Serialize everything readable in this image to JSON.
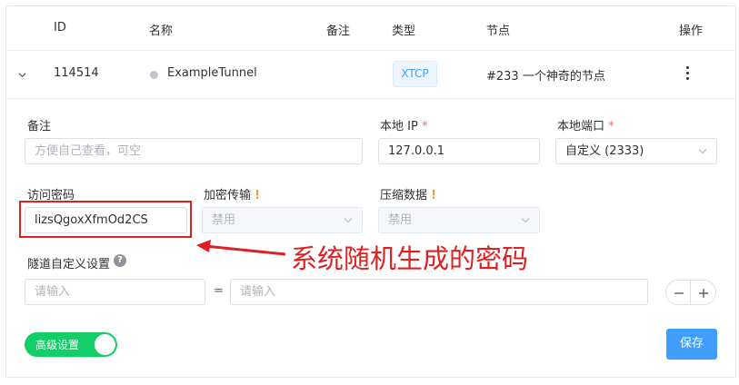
{
  "table": {
    "headers": {
      "id": "ID",
      "name": "名称",
      "remark": "备注",
      "type": "类型",
      "node": "节点",
      "action": "操作"
    },
    "row": {
      "id": "114514",
      "name": "ExampleTunnel",
      "type": "XTCP",
      "node": "#233 一个神奇的节点"
    }
  },
  "form": {
    "remark": {
      "label": "备注",
      "placeholder": "方便自己查看，可空"
    },
    "local_ip": {
      "label": "本地 IP",
      "required_mark": "*",
      "value": "127.0.0.1"
    },
    "local_port": {
      "label": "本地端口",
      "required_mark": "*",
      "value": "自定义 (2333)"
    },
    "access_key": {
      "label": "访问密码",
      "value": "lizsQgoxXfmOd2CS"
    },
    "encryption": {
      "label": "加密传输",
      "warn_mark": "!",
      "value": "禁用"
    },
    "compression": {
      "label": "压缩数据",
      "warn_mark": "!",
      "value": "禁用"
    },
    "custom": {
      "label": "隧道自定义设置",
      "help_mark": "?",
      "key_placeholder": "请输入",
      "equals": "=",
      "value_placeholder": "请输入"
    },
    "advanced_toggle": {
      "label": "高级设置",
      "on": true
    },
    "save_label": "保存"
  },
  "annotation": {
    "text": "系统随机生成的密码",
    "color": "#e02020"
  },
  "colors": {
    "primary": "#409eff",
    "success": "#13ce66",
    "danger": "#f56c6c",
    "warning": "#e6a23c"
  }
}
